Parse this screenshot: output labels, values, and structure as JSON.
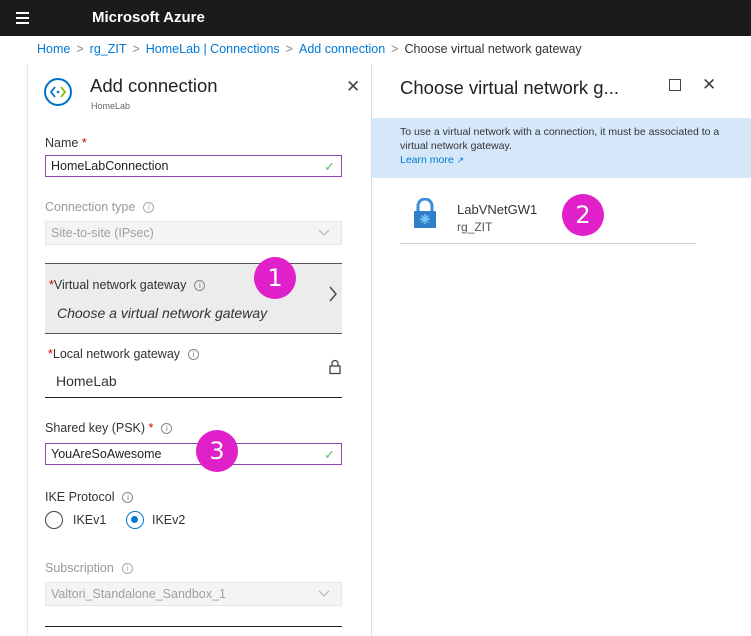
{
  "topbar": {
    "brand": "Microsoft Azure"
  },
  "breadcrumb": [
    {
      "label": "Home"
    },
    {
      "label": "rg_ZIT"
    },
    {
      "label": "HomeLab | Connections"
    },
    {
      "label": "Add connection"
    },
    {
      "label": "Choose virtual network gateway"
    }
  ],
  "left_blade": {
    "title": "Add connection",
    "subtitle": "HomeLab",
    "name": {
      "label": "Name",
      "required": "*",
      "value": "HomeLabConnection"
    },
    "connection_type": {
      "label": "Connection type",
      "value": "Site-to-site (IPsec)"
    },
    "vng": {
      "label": "Virtual network gateway",
      "required": "*",
      "placeholder": "Choose a virtual network gateway"
    },
    "lng": {
      "label": "Local network gateway",
      "required": "*",
      "value": "HomeLab"
    },
    "psk": {
      "label": "Shared key (PSK)",
      "required": "*",
      "value": "YouAreSoAwesome"
    },
    "ike": {
      "label": "IKE Protocol",
      "options": [
        "IKEv1",
        "IKEv2"
      ],
      "selected": "IKEv2"
    },
    "subscription": {
      "label": "Subscription",
      "value": "Valtori_Standalone_Sandbox_1"
    }
  },
  "right_blade": {
    "title": "Choose virtual network g...",
    "info_text": "To use a virtual network with a connection, it must be associated to a virtual network gateway.",
    "learn_more": "Learn more",
    "gateways": [
      {
        "name": "LabVNetGW1",
        "resource_group": "rg_ZIT"
      }
    ]
  },
  "callouts": [
    "1",
    "2",
    "3"
  ],
  "colors": {
    "topbar": "#1b1b1b",
    "link": "#0078d4",
    "callout": "#e020c8",
    "info_bar": "#d5e8fa",
    "input_border": "#8e44ad"
  }
}
